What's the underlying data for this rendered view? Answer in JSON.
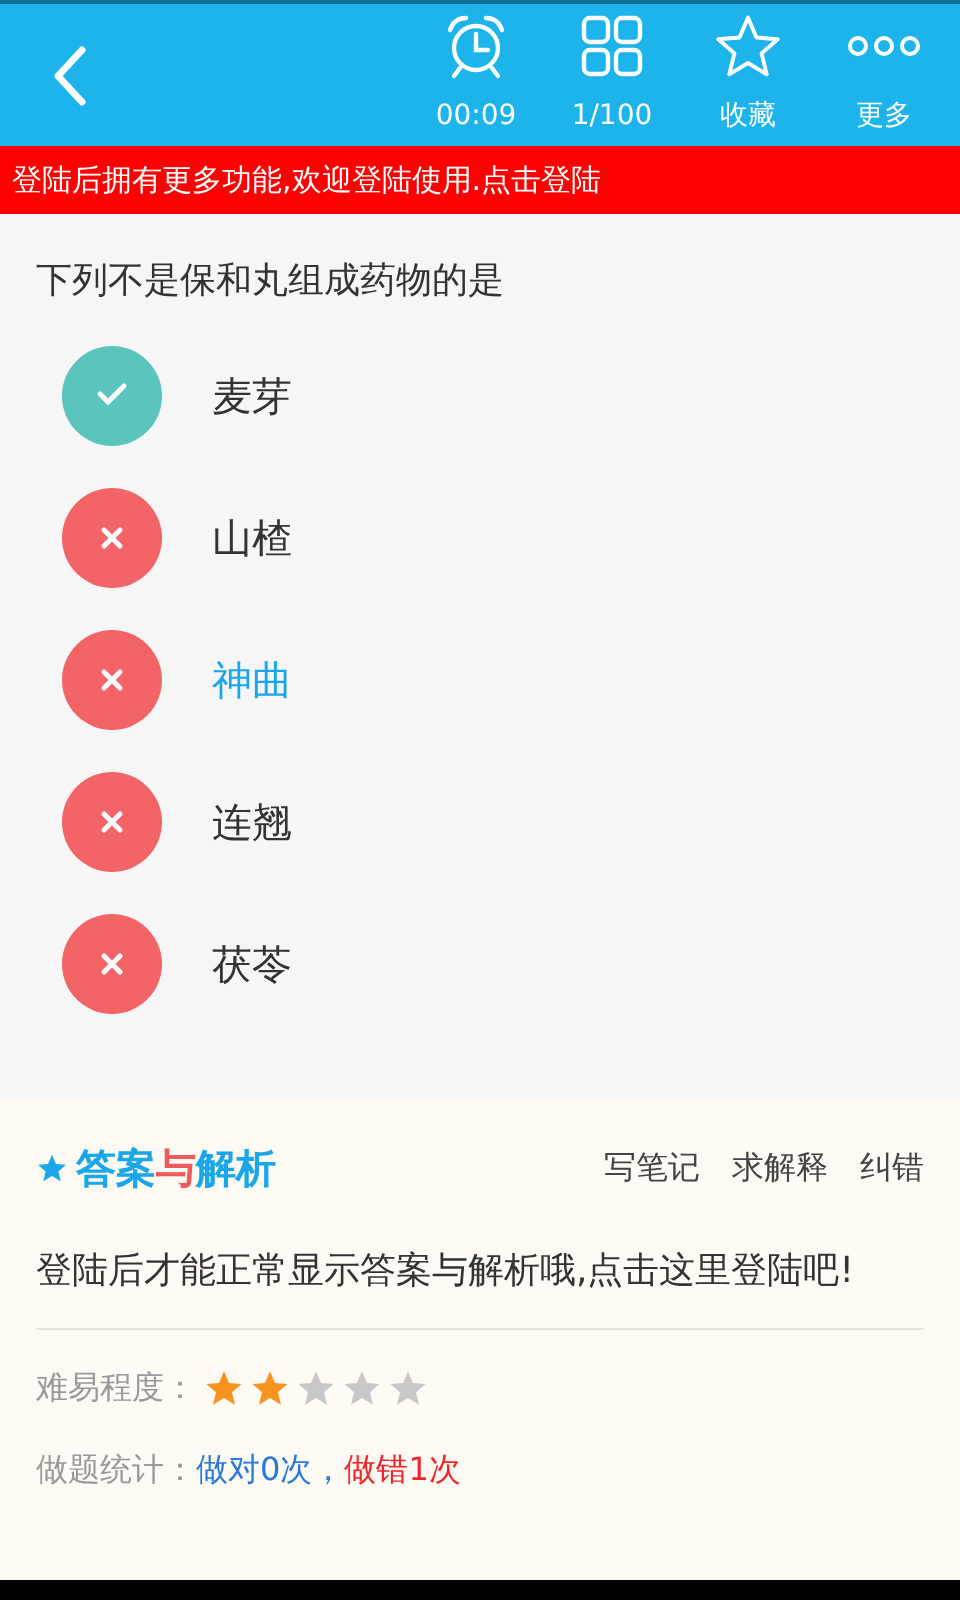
{
  "toolbar": {
    "items": [
      {
        "kind": "timer",
        "label": "00:09"
      },
      {
        "kind": "grid",
        "label": "1/100"
      },
      {
        "kind": "star",
        "label": "收藏"
      },
      {
        "kind": "more",
        "label": "更多"
      }
    ]
  },
  "login_banner": "登陆后拥有更多功能,欢迎登陆使用.点击登陆",
  "question": "下列不是保和丸组成药物的是",
  "options": [
    {
      "text": "麦芽",
      "kind": "correct",
      "selected": false
    },
    {
      "text": "山楂",
      "kind": "wrong",
      "selected": false
    },
    {
      "text": "神曲",
      "kind": "wrong",
      "selected": true
    },
    {
      "text": "连翘",
      "kind": "wrong",
      "selected": false
    },
    {
      "text": "茯苓",
      "kind": "wrong",
      "selected": false
    }
  ],
  "answer_section": {
    "heading": [
      {
        "text": "答案",
        "color": "#1aa7ea"
      },
      {
        "text": "与",
        "color": "#f05a5a"
      },
      {
        "text": "解析",
        "color": "#1aa7ea"
      }
    ],
    "actions": [
      "写笔记",
      "求解释",
      "纠错"
    ],
    "message": "登陆后才能正常显示答案与解析哦,点击这里登陆吧!",
    "difficulty": {
      "label": "难易程度：",
      "stars": 2
    },
    "stats": {
      "label": "做题统计：",
      "correct": "做对0次，",
      "wrong": "做错1次"
    }
  }
}
